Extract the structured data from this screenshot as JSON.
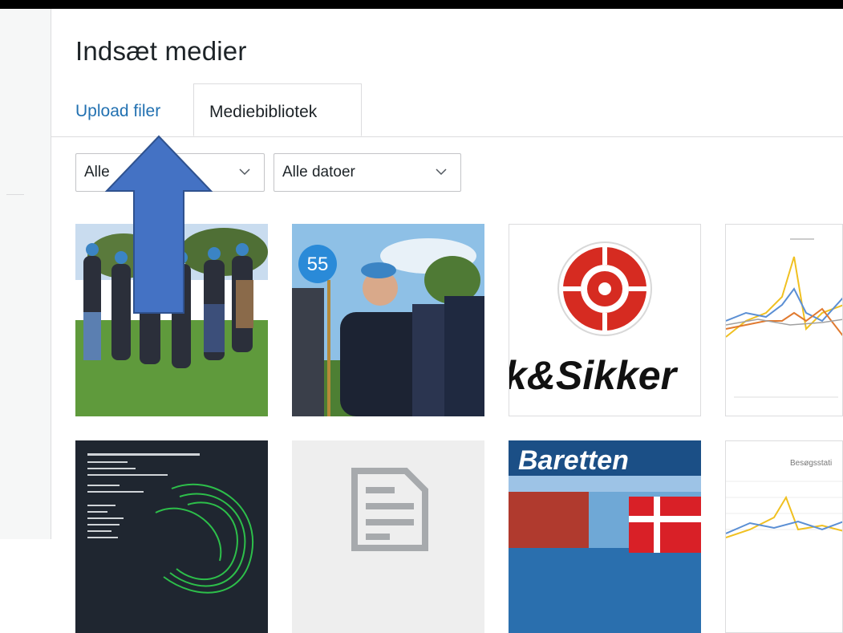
{
  "modal": {
    "title": "Indsæt medier",
    "tabs": [
      {
        "label": "Upload filer",
        "active": false
      },
      {
        "label": "Mediebibliotek",
        "active": true
      }
    ],
    "filters": {
      "type_visible_text": "Alle",
      "date_label": "Alle datoer"
    }
  },
  "media": {
    "items": [
      {
        "kind": "photo",
        "desc": "parade-outdoor"
      },
      {
        "kind": "photo",
        "desc": "veteran-with-55-sign",
        "sign_text": "55"
      },
      {
        "kind": "logo",
        "text": "k&Sikker"
      },
      {
        "kind": "chart-thumbnail"
      },
      {
        "kind": "document-dark"
      },
      {
        "kind": "file-icon"
      },
      {
        "kind": "magazine-cover",
        "text": "Baretten"
      },
      {
        "kind": "chart-thumbnail",
        "text": "Besøgsstati"
      }
    ]
  },
  "annotation": {
    "icon": "up-arrow-icon",
    "color": "#4472c4"
  },
  "colors": {
    "accent": "#2271b1",
    "border": "#dcdcde",
    "arrow": "#4472c4"
  }
}
